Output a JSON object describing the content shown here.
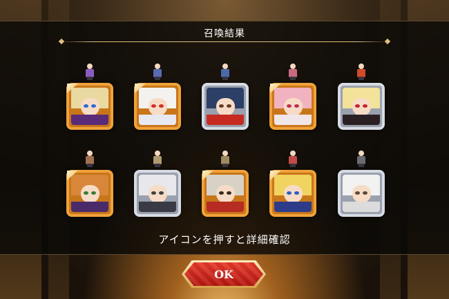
{
  "header": {
    "title": "召喚結果"
  },
  "hint": "アイコンを押すと詳細確認",
  "ok_button": {
    "label": "OK"
  },
  "results": [
    {
      "name": "summon-result-1",
      "frame": "gold",
      "hair": "#e9d9a0",
      "eye": "#2f6bd0",
      "cloth": "#5a2b78",
      "sprite": "#8a5cc0"
    },
    {
      "name": "summon-result-2",
      "frame": "gold",
      "hair": "#f4f2ee",
      "eye": "#d0302a",
      "cloth": "#e8e8f0",
      "sprite": "#5a6ab0"
    },
    {
      "name": "summon-result-3",
      "frame": "silver",
      "hair": "#2c3f66",
      "eye": "#6b3a2a",
      "cloth": "#c62a20",
      "sprite": "#4a6aa8"
    },
    {
      "name": "summon-result-4",
      "frame": "gold",
      "hair": "#f2b3c0",
      "eye": "#c03050",
      "cloth": "#f0e6e8",
      "sprite": "#c86a80"
    },
    {
      "name": "summon-result-5",
      "frame": "silver",
      "hair": "#f3e39a",
      "eye": "#c02828",
      "cloth": "#2a2024",
      "sprite": "#d04a2a"
    },
    {
      "name": "summon-result-6",
      "frame": "gold",
      "hair": "#d8873a",
      "eye": "#3a7a3a",
      "cloth": "#4b2a6a",
      "sprite": "#a07050"
    },
    {
      "name": "summon-result-7",
      "frame": "silver",
      "hair": "#e8e8ec",
      "eye": "#404040",
      "cloth": "#3a3a44",
      "sprite": "#b09a70"
    },
    {
      "name": "summon-result-8",
      "frame": "gold",
      "hair": "#d8d2c6",
      "eye": "#3a2a20",
      "cloth": "#b62c22",
      "sprite": "#a08a60"
    },
    {
      "name": "summon-result-9",
      "frame": "gold",
      "hair": "#f1d360",
      "eye": "#2a60c0",
      "cloth": "#2c3c8a",
      "sprite": "#c04a4a"
    },
    {
      "name": "summon-result-10",
      "frame": "silver",
      "hair": "#f2f2f2",
      "eye": "#5a4a3a",
      "cloth": "#dcdcdc",
      "sprite": "#6a6a70"
    }
  ]
}
